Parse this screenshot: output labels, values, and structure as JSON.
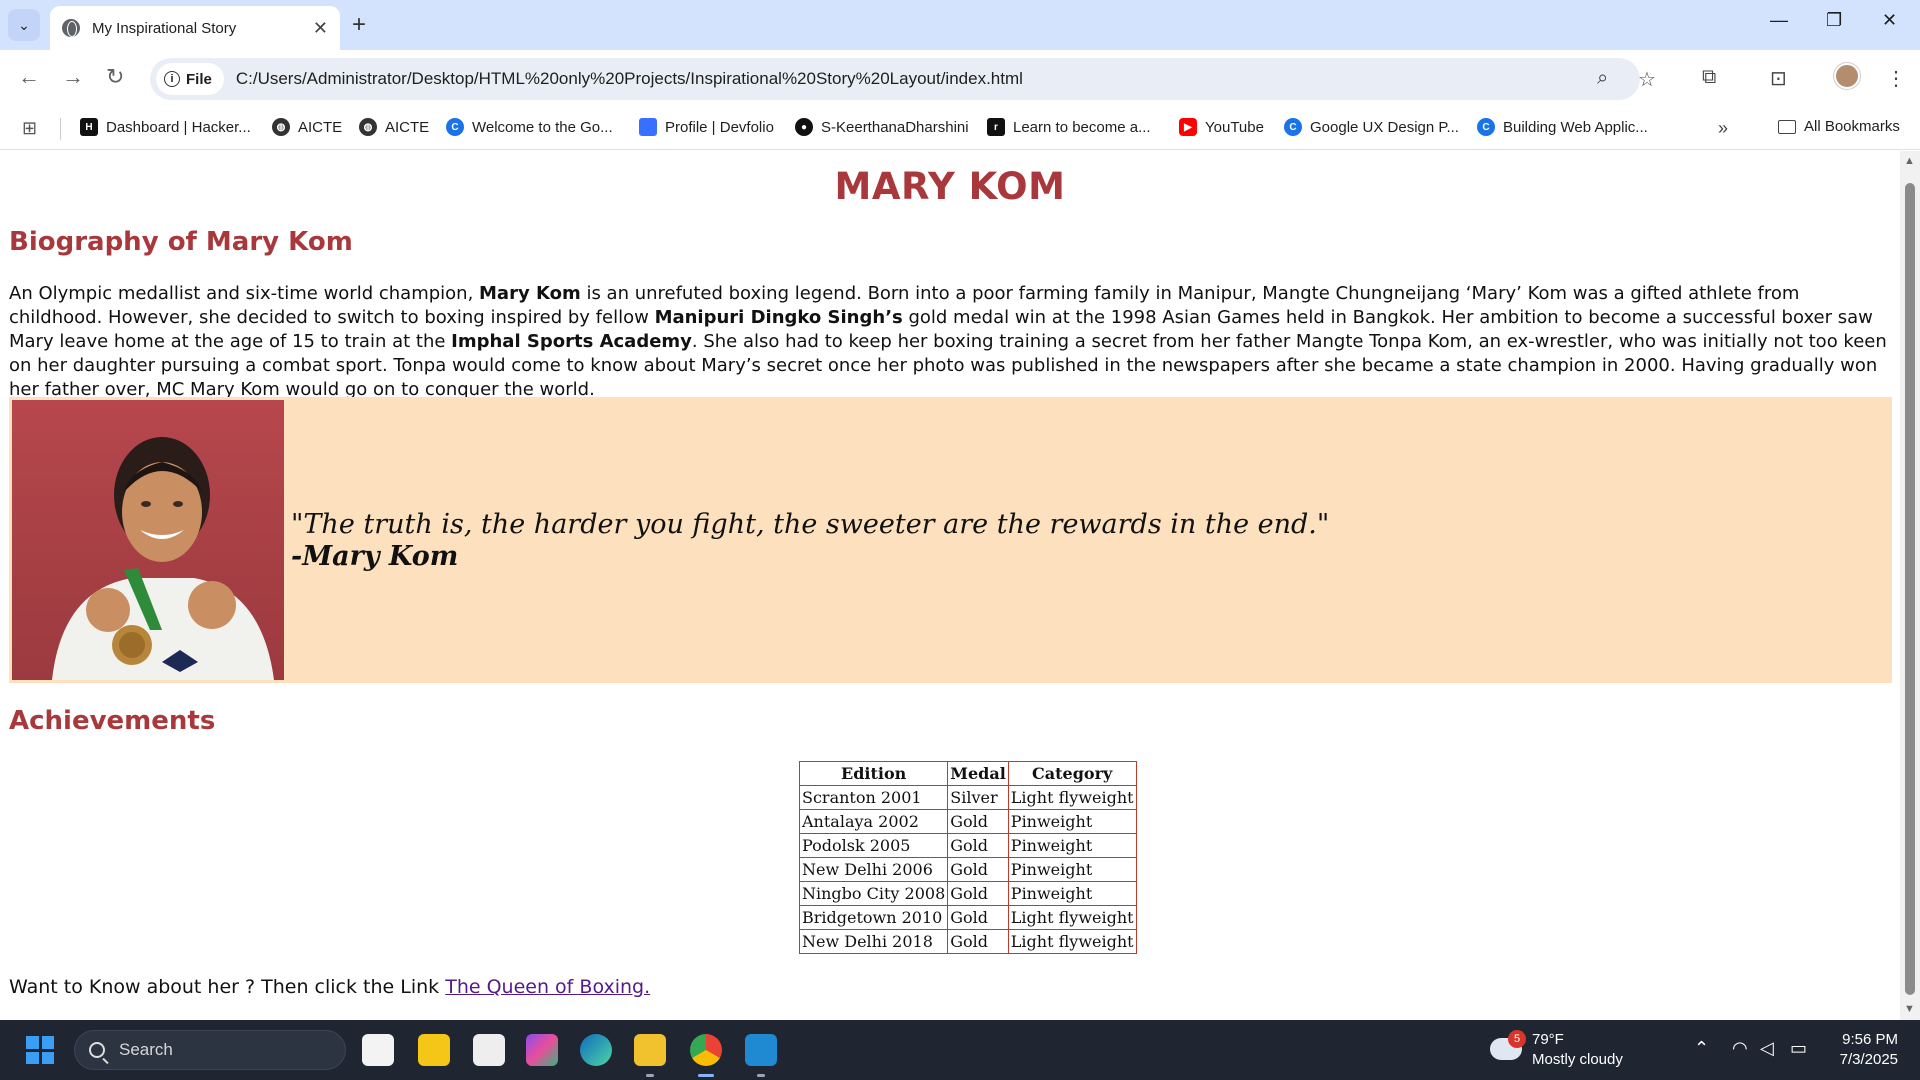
{
  "browser": {
    "tab_title": "My Inspirational Story",
    "file_chip": "File",
    "url": "C:/Users/Administrator/Desktop/HTML%20only%20Projects/Inspirational%20Story%20Layout/index.html",
    "bookmarks": [
      {
        "label": "Dashboard | Hacker...",
        "icon": "hackerearth-icon",
        "color": "#111111"
      },
      {
        "label": "AICTE",
        "icon": "aicte-icon",
        "color": "#333333"
      },
      {
        "label": "AICTE",
        "icon": "aicte-icon",
        "color": "#333333"
      },
      {
        "label": "Welcome to the Go...",
        "icon": "google-course-icon",
        "color": "#1a73e8"
      },
      {
        "label": "Profile | Devfolio",
        "icon": "devfolio-icon",
        "color": "#3770ff"
      },
      {
        "label": "S-KeerthanaDharshini",
        "icon": "github-icon",
        "color": "#111111"
      },
      {
        "label": "Learn to become a...",
        "icon": "roadmap-icon",
        "color": "#111111"
      },
      {
        "label": "YouTube",
        "icon": "youtube-icon",
        "color": "#ff0000"
      },
      {
        "label": "Google UX Design P...",
        "icon": "coursera-icon",
        "color": "#1a73e8"
      },
      {
        "label": "Building Web Applic...",
        "icon": "coursera-icon",
        "color": "#1a73e8"
      }
    ],
    "all_bookmarks": "All Bookmarks"
  },
  "page": {
    "title": "MARY KOM",
    "bio_heading": "Biography of Mary Kom",
    "bio": {
      "p1": "An Olympic medallist and six-time world champion, ",
      "b1": "Mary Kom",
      "p2": " is an unrefuted boxing legend. Born into a poor farming family in Manipur, Mangte Chungneijang ‘Mary’ Kom was a gifted athlete from childhood. However, she decided to switch to boxing inspired by fellow ",
      "b2": "Manipuri Dingko Singh’s",
      "p3": " gold medal win at the 1998 Asian Games held in Bangkok. Her ambition to become a successful boxer saw Mary leave home at the age of 15 to train at the ",
      "b3": "Imphal Sports Academy",
      "p4": ". She also had to keep her boxing training a secret from her father Mangte Tonpa Kom, an ex-wrestler, who was initially not too keen on her daughter pursuing a combat sport. Tonpa would come to know about Mary’s secret once her photo was published in the newspapers after she became a state champion in 2000. Having gradually won her father over, MC Mary Kom would go on to conquer the world."
    },
    "quote": "\"The truth is, the harder you fight, the sweeter are the rewards in the end.\"",
    "quote_author": "-Mary Kom",
    "achievements_heading": "Achievements",
    "table": {
      "headers": [
        "Edition",
        "Medal",
        "Category"
      ],
      "rows": [
        [
          "Scranton 2001",
          "Silver",
          "Light flyweight"
        ],
        [
          "Antalaya 2002",
          "Gold",
          "Pinweight"
        ],
        [
          "Podolsk 2005",
          "Gold",
          "Pinweight"
        ],
        [
          "New Delhi 2006",
          "Gold",
          "Pinweight"
        ],
        [
          "Ningbo City 2008",
          "Gold",
          "Pinweight"
        ],
        [
          "Bridgetown 2010",
          "Gold",
          "Light flyweight"
        ],
        [
          "New Delhi 2018",
          "Gold",
          "Light flyweight"
        ]
      ]
    },
    "want_text": "Want to Know about her ? Then click the Link ",
    "link_text": "The Queen of Boxing."
  },
  "taskbar": {
    "search_placeholder": "Search",
    "weather_temp": "79°F",
    "weather_desc": "Mostly cloudy",
    "weather_badge": "5",
    "time": "9:56 PM",
    "date": "7/3/2025"
  },
  "colors": {
    "heading": "#a8383b",
    "quote_band": "#fde1bf",
    "table_border": "#c0392b",
    "link": "#551a8b"
  }
}
